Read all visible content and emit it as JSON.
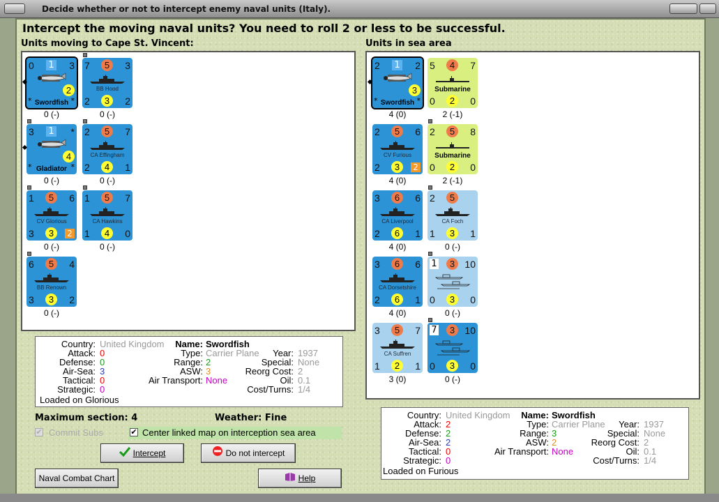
{
  "window": {
    "title": "Decide whether or not to intercept enemy naval units (Italy)."
  },
  "dialog": {
    "heading": "Intercept the moving naval units?  You need to roll 2 or less to be successful.",
    "moving_label": "Units moving to Cape St. Vincent:",
    "sea_label": "Units in sea area"
  },
  "moving_units": [
    {
      "name": "Swordfish",
      "kind": "plane",
      "color": "blue",
      "tl": "0",
      "sq": "1",
      "tr": "3",
      "bot_circle": "2",
      "stars": true,
      "under": "0 (-)"
    },
    {
      "name": "BB Hood",
      "kind": "ship",
      "color": "blue",
      "tl": "7",
      "top_circle": "5",
      "tr": "3",
      "bl": "2",
      "bot_circle": "3",
      "br": "2",
      "under": "0 (-)"
    },
    {
      "name": "Gladiator",
      "kind": "plane",
      "color": "blue",
      "tl": "3",
      "sq": "1",
      "tr": "*",
      "bot_circle": "4",
      "stars": true,
      "under": "0 (-)"
    },
    {
      "name": "CA Effingham",
      "kind": "ship",
      "color": "blue",
      "tl": "2",
      "top_circle": "5",
      "tr": "7",
      "bl": "2",
      "bot_circle": "4",
      "br": "1",
      "under": "0 (-)"
    },
    {
      "name": "CV Glorious",
      "kind": "ship",
      "color": "blue",
      "tl": "1",
      "top_circle": "5",
      "tr": "6",
      "bl": "3",
      "bot_circle": "3",
      "br_sq": "2",
      "under": "0 (-)"
    },
    {
      "name": "CA Hawkins",
      "kind": "ship",
      "color": "blue",
      "tl": "1",
      "top_circle": "5",
      "tr": "7",
      "bl": "1",
      "bot_circle": "4",
      "br": "0",
      "under": "0 (-)"
    },
    {
      "name": "BB Renown",
      "kind": "ship",
      "color": "blue",
      "tl": "6",
      "top_circle": "5",
      "tr": "4",
      "bl": "3",
      "bot_circle": "3",
      "br": "2",
      "under": "0 (-)"
    }
  ],
  "sea_units": [
    {
      "name": "Swordfish",
      "kind": "plane",
      "color": "blue",
      "tl": "2",
      "sq": "1",
      "tr": "2",
      "bot_circle": "3",
      "stars": true,
      "under": "4 (0)"
    },
    {
      "name": "Submarine",
      "kind": "sub",
      "color": "green",
      "tl": "5",
      "top_circle": "4",
      "tr": "7",
      "bl": "0",
      "bot_circle": "2",
      "br": "0",
      "under": "2 (-1)"
    },
    {
      "name": "CV Furious",
      "kind": "ship",
      "color": "blue",
      "tl": "2",
      "top_circle": "5",
      "tr": "6",
      "bl": "2",
      "bot_circle": "3",
      "br_sq": "2",
      "under": "4 (0)"
    },
    {
      "name": "Submarine",
      "kind": "sub",
      "color": "green",
      "tl": "2",
      "top_circle": "5",
      "tr": "8",
      "bl": "0",
      "bot_circle": "2",
      "br": "0",
      "under": "2 (-1)"
    },
    {
      "name": "CA Liverpool",
      "kind": "ship",
      "color": "blue",
      "tl": "3",
      "top_circle": "6",
      "tr": "6",
      "bl": "2",
      "bot_circle": "6",
      "br": "1",
      "under": "4 (0)"
    },
    {
      "name": "CA Foch",
      "kind": "ship",
      "color": "lblue",
      "tl": "2",
      "top_circle": "5",
      "tr": "",
      "bl": "1",
      "bot_circle": "3",
      "br": "1",
      "under": "0 (-)"
    },
    {
      "name": "CA Dorsetshire",
      "kind": "ship",
      "color": "blue",
      "tl": "3",
      "top_circle": "6",
      "tr": "6",
      "bl": "2",
      "bot_circle": "6",
      "br": "1",
      "under": "4 (0)"
    },
    {
      "name": "",
      "kind": "transport",
      "color": "lblue",
      "tl_sq": "1",
      "top_circle": "3",
      "tr": "10",
      "bl": "0",
      "bot_circle": "3",
      "br": "0",
      "under": "0 (-)"
    },
    {
      "name": "CA Suffren",
      "kind": "ship",
      "color": "lblue",
      "tl": "3",
      "top_circle": "5",
      "tr": "7",
      "bl": "1",
      "bot_circle": "2",
      "br": "1",
      "under": "3 (0)"
    },
    {
      "name": "",
      "kind": "transport",
      "color": "blue",
      "tl_sq": "7",
      "top_circle": "3",
      "tr": "10",
      "bl": "0",
      "bot_circle": "3",
      "br": "0",
      "under": "0 (-)"
    }
  ],
  "info_left": {
    "country_label": "Country:",
    "country": "United Kingdom",
    "attack_label": "Attack:",
    "attack": "0",
    "defense_label": "Defense:",
    "defense": "0",
    "airsea_label": "Air-Sea:",
    "airsea": "3",
    "tactical_label": "Tactical:",
    "tactical": "0",
    "strategic_label": "Strategic:",
    "strategic": "0",
    "loaded": "Loaded on Glorious",
    "name_label": "Name:",
    "name": "Swordfish",
    "type_label": "Type:",
    "type": "Carrier Plane",
    "range_label": "Range:",
    "range": "2",
    "asw_label": "ASW:",
    "asw": "3",
    "airtrans_label": "Air Transport:",
    "airtrans": "None",
    "year_label": "Year:",
    "year": "1937",
    "special_label": "Special:",
    "special": "None",
    "reorg_label": "Reorg Cost:",
    "reorg": "2",
    "oil_label": "Oil:",
    "oil": "0.1",
    "cost_label": "Cost/Turns:",
    "cost": "1/4"
  },
  "info_right": {
    "country_label": "Country:",
    "country": "United Kingdom",
    "attack_label": "Attack:",
    "attack": "2",
    "defense_label": "Defense:",
    "defense": "2",
    "airsea_label": "Air-Sea:",
    "airsea": "2",
    "tactical_label": "Tactical:",
    "tactical": "0",
    "strategic_label": "Strategic:",
    "strategic": "0",
    "loaded": "Loaded on Furious",
    "name_label": "Name:",
    "name": "Swordfish",
    "type_label": "Type:",
    "type": "Carrier Plane",
    "range_label": "Range:",
    "range": "3",
    "asw_label": "ASW:",
    "asw": "2",
    "airtrans_label": "Air Transport:",
    "airtrans": "None",
    "year_label": "Year:",
    "year": "1937",
    "special_label": "Special:",
    "special": "None",
    "reorg_label": "Reorg Cost:",
    "reorg": "2",
    "oil_label": "Oil:",
    "oil": "0.1",
    "cost_label": "Cost/Turns:",
    "cost": "1/4"
  },
  "status": {
    "max_section": "Maximum section: 4",
    "weather": "Weather:  Fine"
  },
  "options": {
    "commit_subs": "Commit Subs",
    "center_map": "Center linked map on interception sea area"
  },
  "buttons": {
    "intercept": "Intercept",
    "do_not_intercept": "Do not intercept",
    "naval_chart": "Naval Combat Chart",
    "help": "Help"
  }
}
